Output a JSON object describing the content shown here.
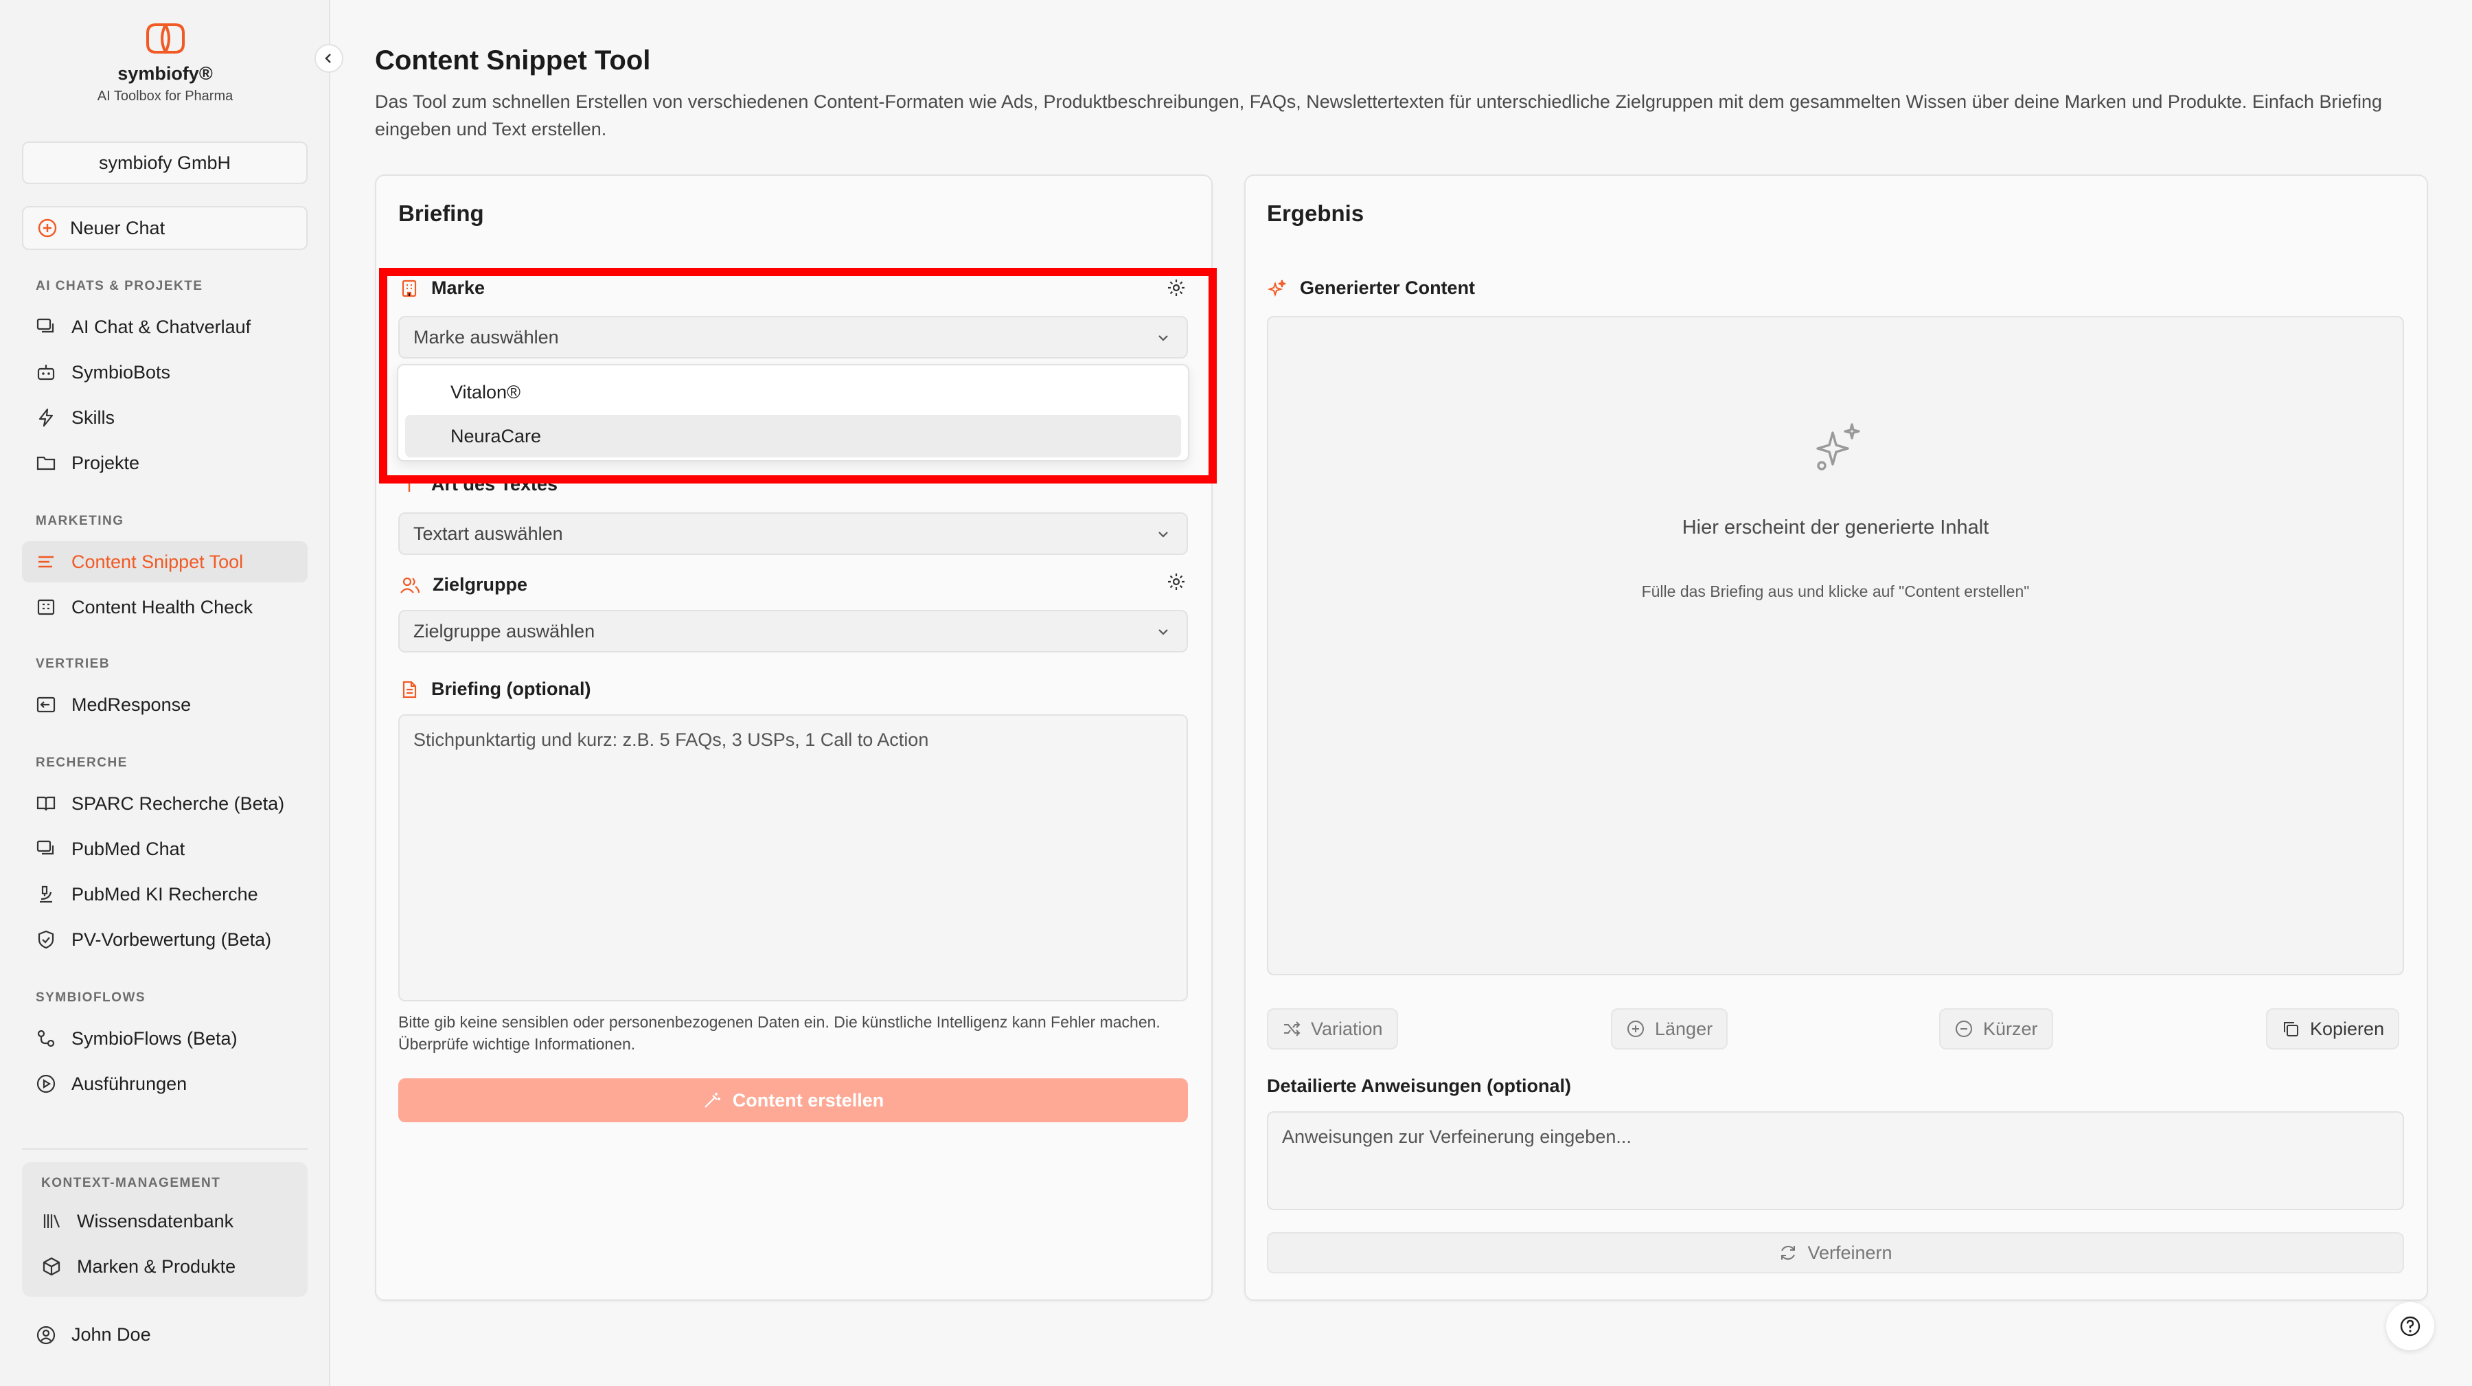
{
  "colors": {
    "accent": "#f15a24",
    "primary_button": "#fea995",
    "highlight": "#ff0000"
  },
  "brand": {
    "name": "symbiofy®",
    "tagline": "AI Toolbox for Pharma"
  },
  "company": "symbiofy GmbH",
  "new_chat": "Neuer Chat",
  "sidebar": {
    "sections": [
      {
        "title": "AI CHATS & PROJEKTE",
        "items": [
          {
            "label": "AI Chat & Chatverlauf",
            "icon": "chat-icon"
          },
          {
            "label": "SymbioBots",
            "icon": "bot-icon"
          },
          {
            "label": "Skills",
            "icon": "lightning-icon"
          },
          {
            "label": "Projekte",
            "icon": "folder-icon"
          }
        ]
      },
      {
        "title": "MARKETING",
        "items": [
          {
            "label": "Content Snippet Tool",
            "icon": "lines-icon",
            "active": true
          },
          {
            "label": "Content Health Check",
            "icon": "building-icon"
          }
        ]
      },
      {
        "title": "VERTRIEB",
        "items": [
          {
            "label": "MedResponse",
            "icon": "reply-icon"
          }
        ]
      },
      {
        "title": "RECHERCHE",
        "items": [
          {
            "label": "SPARC Recherche (Beta)",
            "icon": "book-icon"
          },
          {
            "label": "PubMed Chat",
            "icon": "chat-icon"
          },
          {
            "label": "PubMed KI Recherche",
            "icon": "microscope-icon"
          },
          {
            "label": "PV-Vorbewertung (Beta)",
            "icon": "shield-icon"
          }
        ]
      },
      {
        "title": "SYMBIOFLOWS",
        "items": [
          {
            "label": "SymbioFlows (Beta)",
            "icon": "flow-icon"
          },
          {
            "label": "Ausführungen",
            "icon": "play-icon"
          }
        ]
      }
    ],
    "context": {
      "title": "KONTEXT-MANAGEMENT",
      "items": [
        {
          "label": "Wissensdatenbank",
          "icon": "library-icon"
        },
        {
          "label": "Marken & Produkte",
          "icon": "box-icon"
        }
      ]
    },
    "user": "John Doe"
  },
  "page": {
    "title": "Content Snippet Tool",
    "description": "Das Tool zum schnellen Erstellen von verschiedenen Content-Formaten wie Ads, Produktbeschreibungen, FAQs, Newslettertexten für unterschiedliche Zielgruppen mit dem gesammelten Wissen über deine Marken und Produkte. Einfach Briefing eingeben und Text erstellen."
  },
  "briefing": {
    "title": "Briefing",
    "marke": {
      "label": "Marke",
      "placeholder": "Marke auswählen",
      "options": [
        "Vitalon®",
        "NeuraCare"
      ],
      "highlighted_option": "NeuraCare"
    },
    "art": {
      "label": "Art des Textes",
      "placeholder": "Textart auswählen"
    },
    "zielgruppe": {
      "label": "Zielgruppe",
      "placeholder": "Zielgruppe auswählen"
    },
    "briefing_field": {
      "label": "Briefing (optional)",
      "placeholder": "Stichpunktartig und kurz: z.B. 5 FAQs, 3 USPs, 1 Call to Action"
    },
    "hint": "Bitte gib keine sensiblen oder personenbezogenen Daten ein. Die künstliche Intelligenz kann Fehler machen. Überprüfe wichtige Informationen.",
    "submit": "Content erstellen"
  },
  "result": {
    "title": "Ergebnis",
    "generated_label": "Generierter Content",
    "empty_title": "Hier erscheint der generierte Inhalt",
    "empty_sub": "Fülle das Briefing aus und klicke auf \"Content erstellen\"",
    "actions": {
      "variation": "Variation",
      "longer": "Länger",
      "shorter": "Kürzer",
      "copy": "Kopieren"
    },
    "refine_label": "Detailierte Anweisungen (optional)",
    "refine_placeholder": "Anweisungen zur Verfeinerung eingeben...",
    "refine_button": "Verfeinern"
  }
}
